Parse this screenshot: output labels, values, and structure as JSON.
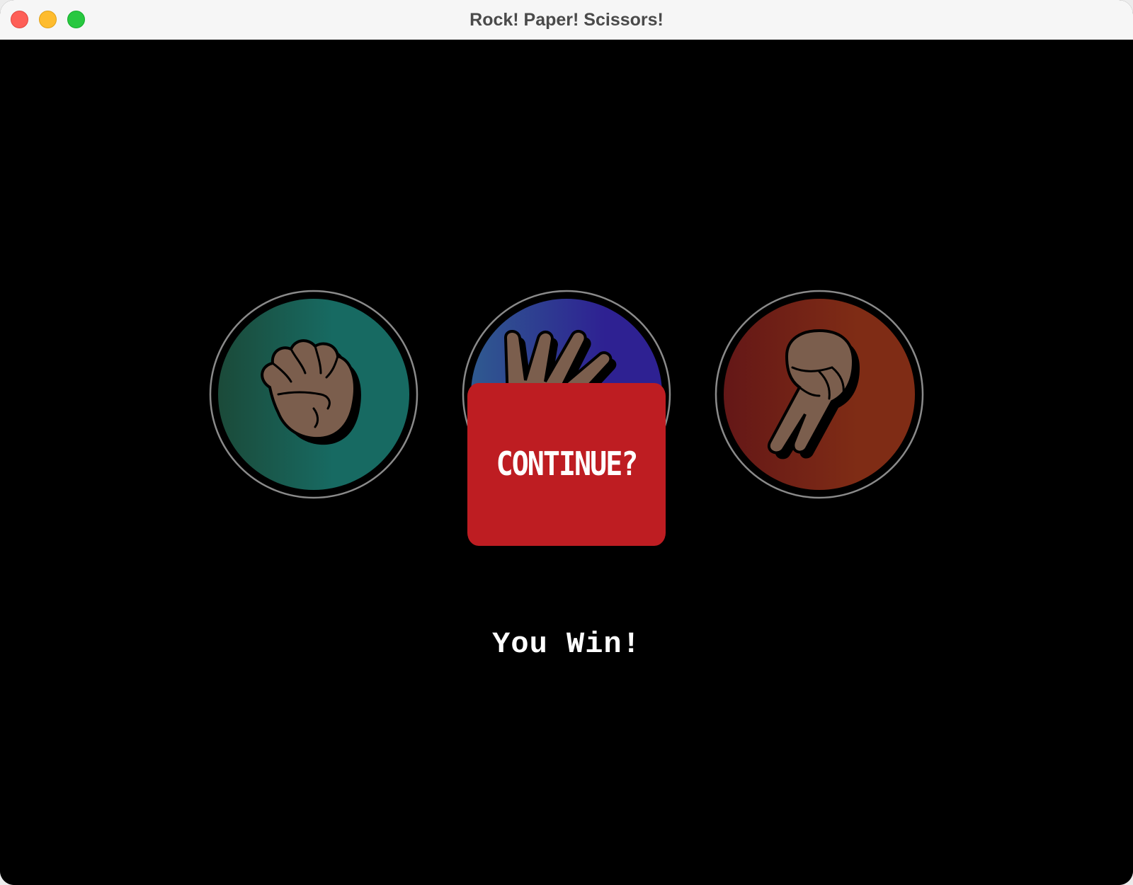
{
  "window": {
    "title": "Rock! Paper! Scissors!"
  },
  "choices": [
    {
      "id": "rock",
      "icon": "fist-icon",
      "gradient": [
        "#1b4a39",
        "#176a62"
      ]
    },
    {
      "id": "paper",
      "icon": "open-hand-icon",
      "gradient": [
        "#2f5a90",
        "#2e2192"
      ]
    },
    {
      "id": "scissors",
      "icon": "peace-hand-icon",
      "gradient": [
        "#641717",
        "#7f2c15"
      ]
    }
  ],
  "continue_button": {
    "label": "CONTINUE?",
    "color": "#be1d22"
  },
  "result": {
    "text": "You Win!"
  },
  "colors": {
    "background": "#000000",
    "skin": "#7b5e4d",
    "ring": "#8a8a8a"
  }
}
